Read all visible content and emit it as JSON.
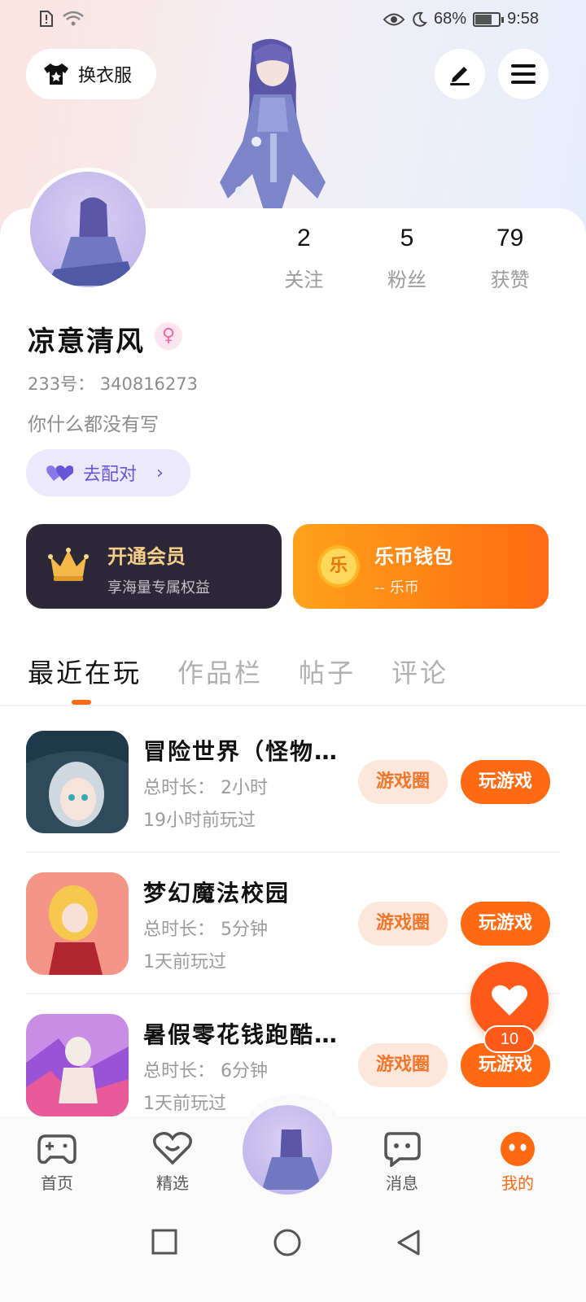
{
  "status_bar": {
    "battery": "68%",
    "time": "9:58",
    "battery_level": 0.68
  },
  "header": {
    "outfit_label": "换衣服"
  },
  "profile": {
    "username": "凉意清风",
    "gender_symbol": "♀",
    "uid": "233号：  340816273",
    "bio": "你什么都没有写",
    "match_label": "去配对",
    "stats": [
      {
        "value": "2",
        "label": "关注"
      },
      {
        "value": "5",
        "label": "粉丝"
      },
      {
        "value": "79",
        "label": "获赞"
      }
    ]
  },
  "promo": {
    "vip_title": "开通会员",
    "vip_sub": "享海量专属权益",
    "wallet_title": "乐币钱包",
    "wallet_sub": "-- 乐币",
    "wallet_coin": "乐"
  },
  "tabs": [
    "最近在玩",
    "作品栏",
    "帖子",
    "评论"
  ],
  "games": [
    {
      "name": "冒险世界（怪物…",
      "duration": "总时长：  2小时",
      "last_played": "19小时前玩过",
      "circle_label": "游戏圈",
      "play_label": "玩游戏"
    },
    {
      "name": "梦幻魔法校园",
      "duration": "总时长：  5分钟",
      "last_played": "1天前玩过",
      "circle_label": "游戏圈",
      "play_label": "玩游戏"
    },
    {
      "name": "暑假零花钱跑酷…",
      "duration": "总时长：  6分钟",
      "last_played": "1天前玩过",
      "circle_label": "游戏圈",
      "play_label": "玩游戏"
    }
  ],
  "fab": {
    "count": "10"
  },
  "bottom_nav": [
    {
      "label": "首页",
      "icon": "gamepad-icon"
    },
    {
      "label": "精选",
      "icon": "heart-chat-icon"
    },
    {
      "label": "消息",
      "icon": "message-icon"
    },
    {
      "label": "我的",
      "icon": "face-icon"
    }
  ],
  "colors": {
    "accent": "#ff6a12",
    "vip_bg": "#2d2837",
    "match": "#6956d6"
  }
}
